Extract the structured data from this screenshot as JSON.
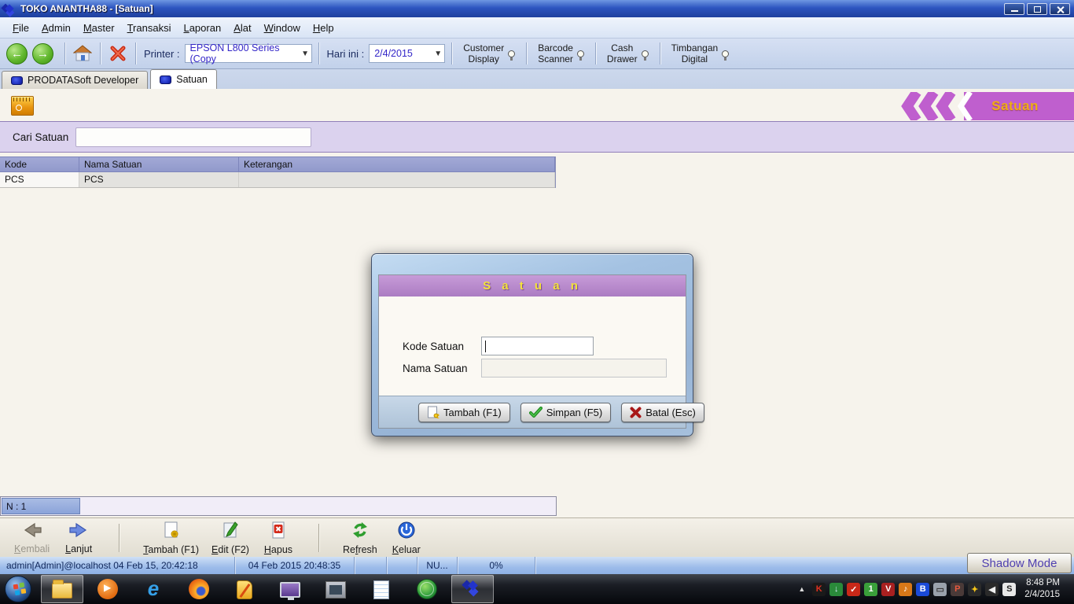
{
  "window": {
    "title": "TOKO ANANTHA88 - [Satuan]",
    "controls": [
      "minimize",
      "restore",
      "close"
    ]
  },
  "menu": {
    "items": [
      {
        "label": "File",
        "underline_index": 0
      },
      {
        "label": "Admin",
        "underline_index": 0
      },
      {
        "label": "Master",
        "underline_index": 0
      },
      {
        "label": "Transaksi",
        "underline_index": 0
      },
      {
        "label": "Laporan",
        "underline_index": 0
      },
      {
        "label": "Alat",
        "underline_index": 0
      },
      {
        "label": "Window",
        "underline_index": 0
      },
      {
        "label": "Help",
        "underline_index": 0
      }
    ]
  },
  "toolbar": {
    "printer_label": "Printer :",
    "printer_value": "EPSON L800 Series (Copy",
    "date_label": "Hari ini :",
    "date_value": "2/4/2015",
    "devices": [
      {
        "label": "Customer\nDisplay",
        "icon": "lamp-icon"
      },
      {
        "label": "Barcode\nScanner",
        "icon": "lamp-icon"
      },
      {
        "label": "Cash\nDrawer",
        "icon": "lamp-icon"
      },
      {
        "label": "Timbangan\nDigital",
        "icon": "lamp-icon"
      }
    ]
  },
  "tabs": [
    {
      "label": "PRODATASoft Developer",
      "active": false
    },
    {
      "label": "Satuan",
      "active": true
    }
  ],
  "banner": {
    "title": "Satuan"
  },
  "search": {
    "label": "Cari Satuan",
    "value": "",
    "placeholder": ""
  },
  "table": {
    "columns": [
      "Kode",
      "Nama Satuan",
      "Keterangan"
    ],
    "rows": [
      [
        "PCS",
        "PCS",
        ""
      ]
    ]
  },
  "record_bar": {
    "count_label": "N : 1"
  },
  "dialog": {
    "title": "S a t u a n",
    "fields": [
      {
        "label": "Kode Satuan",
        "value": ""
      },
      {
        "label": "Nama Satuan",
        "value": ""
      }
    ],
    "buttons": [
      {
        "label": "Tambah (F1)",
        "icon": "add-page-icon"
      },
      {
        "label": "Simpan (F5)",
        "icon": "check-icon"
      },
      {
        "label": "Batal (Esc)",
        "icon": "cross-icon"
      }
    ]
  },
  "bottom_toolbar": {
    "buttons": [
      {
        "label": "Kembali",
        "underline_index": 0,
        "icon": "back-arrow-icon",
        "disabled": true
      },
      {
        "label": "Lanjut",
        "underline_index": 0,
        "icon": "forward-arrow-icon"
      },
      {
        "label": "Tambah (F1)",
        "underline_index": 0,
        "icon": "add-page-icon",
        "sep_before": true
      },
      {
        "label": "Edit (F2)",
        "underline_index": 0,
        "icon": "edit-page-icon"
      },
      {
        "label": "Hapus",
        "underline_index": 0,
        "icon": "delete-page-icon"
      },
      {
        "label": "Refresh",
        "underline_index": 2,
        "icon": "refresh-icon",
        "sep_before": true
      },
      {
        "label": "Keluar",
        "underline_index": 0,
        "icon": "power-icon"
      }
    ]
  },
  "status_bar": {
    "user_session": "admin[Admin]@localhost 04 Feb 15, 20:42:18",
    "datetime": "04 Feb 2015 20:48:35",
    "numlock": "NU...",
    "progress": "0%"
  },
  "shadow_mode": {
    "label": "Shadow Mode"
  },
  "taskbar": {
    "apps": [
      {
        "icon": "explorer",
        "name": "taskbar-windows-explorer",
        "active": true
      },
      {
        "icon": "wmp",
        "name": "taskbar-media-player",
        "active": false
      },
      {
        "icon": "ie",
        "name": "taskbar-internet-explorer",
        "active": false
      },
      {
        "icon": "firefox",
        "name": "taskbar-firefox",
        "active": false
      },
      {
        "icon": "sim",
        "name": "taskbar-sim-tool",
        "active": false
      },
      {
        "icon": "monitor",
        "name": "taskbar-remote-desktop",
        "active": false
      },
      {
        "icon": "window",
        "name": "taskbar-app-window",
        "active": false
      },
      {
        "icon": "notepad",
        "name": "taskbar-notepad",
        "active": false
      },
      {
        "icon": "globe",
        "name": "taskbar-globe-app",
        "active": false
      },
      {
        "icon": "app",
        "name": "taskbar-prodatasoft",
        "active": true
      }
    ],
    "tray": [
      {
        "name": "kaspersky-tray-icon",
        "glyph": "K",
        "bg": "#1a1a1a",
        "fg": "#e03020"
      },
      {
        "name": "download-manager-tray-icon",
        "glyph": "↓",
        "bg": "#2a8a3a",
        "fg": "#d8f0ff"
      },
      {
        "name": "checker-tray-icon",
        "glyph": "✓",
        "bg": "#c82818",
        "fg": "#ffffff"
      },
      {
        "name": "usb-eject-tray-icon",
        "glyph": "1",
        "bg": "#3aa03a",
        "fg": "#ffffff"
      },
      {
        "name": "shield-tray-icon",
        "glyph": "V",
        "bg": "#a82020",
        "fg": "#ffffff"
      },
      {
        "name": "audio-app-tray-icon",
        "glyph": "♪",
        "bg": "#d87818",
        "fg": "#ffffff"
      },
      {
        "name": "bluetooth-tray-icon",
        "glyph": "B",
        "bg": "#1a4ad8",
        "fg": "#ffffff"
      },
      {
        "name": "touchpad-tray-icon",
        "glyph": "▭",
        "bg": "#9aa2ac",
        "fg": "#3a3a3a"
      },
      {
        "name": "printer-tray-icon",
        "glyph": "P",
        "bg": "#4a3a38",
        "fg": "#e85a40"
      },
      {
        "name": "spark-tray-icon",
        "glyph": "✦",
        "bg": "#2a2a2a",
        "fg": "#f5c518"
      },
      {
        "name": "volume-tray-icon",
        "glyph": "◀",
        "bg": "#2a2a2a",
        "fg": "#f0f0f0"
      },
      {
        "name": "shadow-defender-tray-icon",
        "glyph": "S",
        "bg": "#e8e8e8",
        "fg": "#222222"
      }
    ],
    "clock": {
      "time": "8:48 PM",
      "date": "2/4/2015"
    }
  },
  "colors": {
    "titlebar_blue": "#2d55c0",
    "banner_purple": "#bf5fce",
    "dialog_title_purple": "#b183c6",
    "table_header_blue": "#99a0ce",
    "search_row_lavender": "#dbd2ee",
    "record_cell_blue": "#8ba3d9",
    "status_blue": "#9dbcea",
    "accent_yellow": "#eead17"
  }
}
